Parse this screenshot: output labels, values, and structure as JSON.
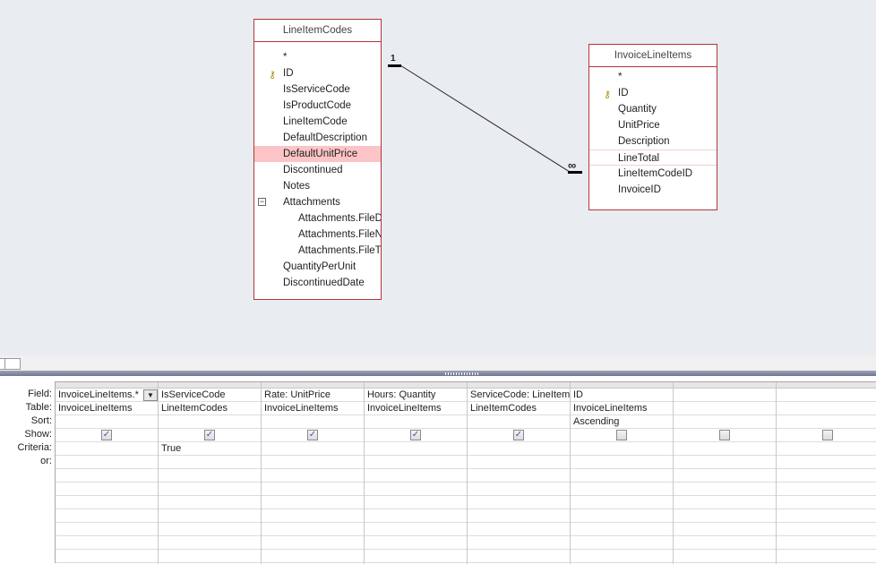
{
  "tables": [
    {
      "name": "LineItemCodes",
      "fields": [
        "*",
        "ID",
        "IsServiceCode",
        "IsProductCode",
        "LineItemCode",
        "DefaultDescription",
        "DefaultUnitPrice",
        "Discontinued",
        "Notes",
        "Attachments",
        "Attachments.FileData",
        "Attachments.FileName",
        "Attachments.FileType",
        "QuantityPerUnit",
        "DiscontinuedDate"
      ]
    },
    {
      "name": "InvoiceLineItems",
      "fields": [
        "*",
        "ID",
        "Quantity",
        "UnitPrice",
        "Description",
        "LineTotal",
        "LineItemCodeID",
        "InvoiceID"
      ]
    }
  ],
  "relationship": {
    "one": "1",
    "many": "∞"
  },
  "grid": {
    "row_labels": [
      "Field:",
      "Table:",
      "Sort:",
      "Show:",
      "Criteria:",
      "or:"
    ],
    "columns": [
      {
        "field": "InvoiceLineItems.*",
        "table": "InvoiceLineItems",
        "sort": "",
        "show": true,
        "criteria": ""
      },
      {
        "field": "IsServiceCode",
        "table": "LineItemCodes",
        "sort": "",
        "show": true,
        "criteria": "True"
      },
      {
        "field": "Rate: UnitPrice",
        "table": "InvoiceLineItems",
        "sort": "",
        "show": true,
        "criteria": ""
      },
      {
        "field": "Hours: Quantity",
        "table": "InvoiceLineItems",
        "sort": "",
        "show": true,
        "criteria": ""
      },
      {
        "field": "ServiceCode: LineItemCode",
        "table": "LineItemCodes",
        "sort": "",
        "show": true,
        "criteria": ""
      },
      {
        "field": "ID",
        "table": "InvoiceLineItems",
        "sort": "Ascending",
        "show": false,
        "criteria": ""
      },
      {
        "field": "",
        "table": "",
        "sort": "",
        "show": false,
        "criteria": ""
      },
      {
        "field": "",
        "table": "",
        "sort": "",
        "show": false,
        "criteria": ""
      }
    ]
  }
}
